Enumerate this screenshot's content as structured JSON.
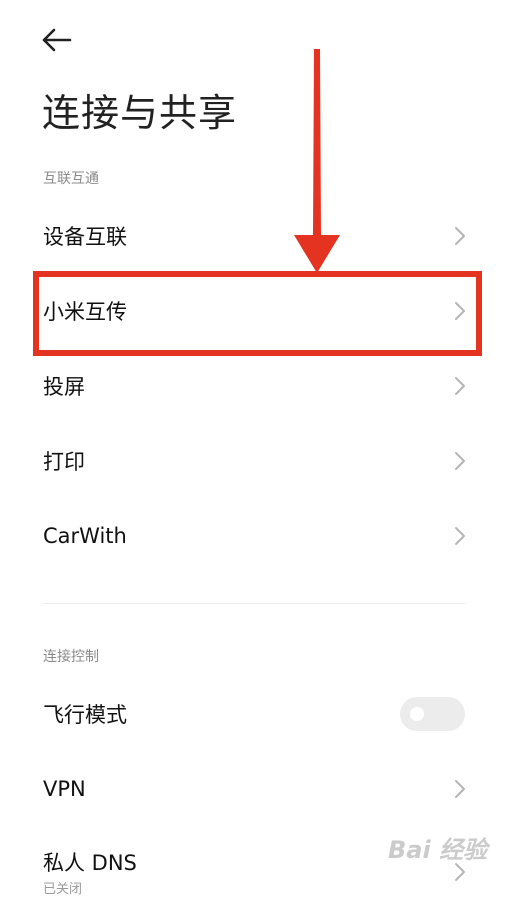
{
  "header": {
    "title": "连接与共享"
  },
  "sections": [
    {
      "label": "互联互通",
      "items": [
        {
          "label": "设备互联"
        },
        {
          "label": "小米互传"
        },
        {
          "label": "投屏"
        },
        {
          "label": "打印"
        },
        {
          "label": "CarWith"
        }
      ]
    },
    {
      "label": "连接控制",
      "items": [
        {
          "label": "飞行模式",
          "toggle": "off"
        },
        {
          "label": "VPN"
        },
        {
          "label": "私人 DNS",
          "subtitle": "已关闭"
        }
      ]
    }
  ],
  "annotation": {
    "color": "#e53322"
  },
  "watermark": "Bai 经验"
}
